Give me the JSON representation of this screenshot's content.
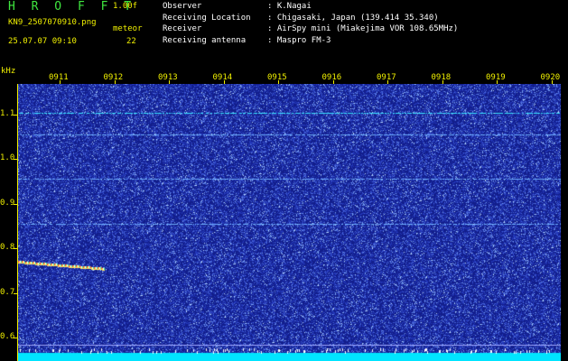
{
  "header": {
    "app_title": "H R O F F T",
    "version": "1.00f",
    "filename": "KN9_2507070910.png",
    "meteor_label": "meteor",
    "datetime": "25.07.07 09:10",
    "count": "22"
  },
  "info": [
    {
      "label": "Observer",
      "value": "K.Nagai"
    },
    {
      "label": "Receiving Location",
      "value": "Chigasaki, Japan (139.414 35.340)"
    },
    {
      "label": "Receiver",
      "value": "AirSpy mini (Miakejima VOR 108.65MHz)"
    },
    {
      "label": "Receiving antenna",
      "value": "Maspro FM-3"
    }
  ],
  "axis": {
    "y_unit": "kHz",
    "y_ticks": [
      "1.1",
      "1.0",
      "0.9",
      "0.8",
      "0.7",
      "0.6"
    ],
    "x_ticks": [
      "0911",
      "0912",
      "0913",
      "0914",
      "0915",
      "0916",
      "0917",
      "0918",
      "0919",
      "0920"
    ]
  },
  "spectrogram": {
    "freq_range_khz": [
      0.58,
      1.18
    ],
    "time_range": [
      "0910",
      "0920"
    ],
    "carriers_khz": [
      1.118,
      1.07,
      0.975,
      0.878
    ],
    "meteor_echo": {
      "start_time": "0910",
      "end_time": "0911.6",
      "freq_khz_start": 0.795,
      "freq_khz_end": 0.78
    },
    "background_color": "#1a2a9a",
    "carrier_color": "#39e6ff",
    "baseline_color": "#00e5ff"
  }
}
